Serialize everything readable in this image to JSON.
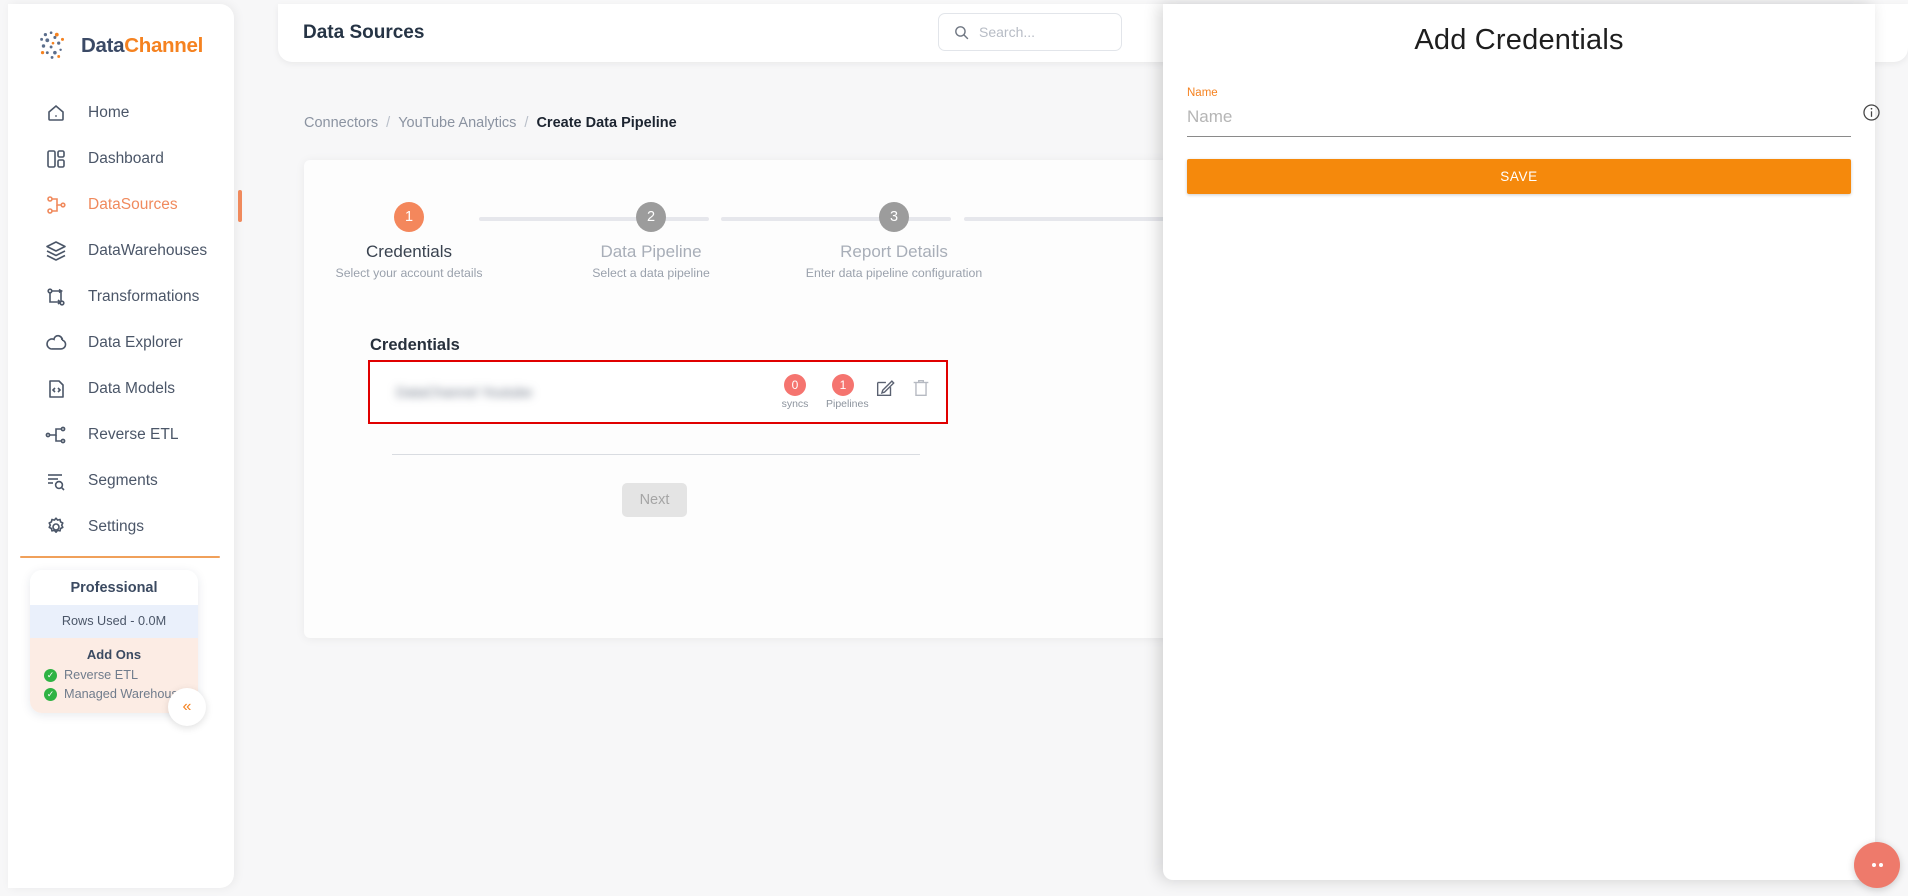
{
  "brand": {
    "part1": "Data",
    "part2": "Channel"
  },
  "sidebar": {
    "items": [
      {
        "label": "Home",
        "icon": "home-icon",
        "active": false
      },
      {
        "label": "Dashboard",
        "icon": "dashboard-icon",
        "active": false
      },
      {
        "label": "DataSources",
        "icon": "datasources-icon",
        "active": true
      },
      {
        "label": "DataWarehouses",
        "icon": "warehouse-icon",
        "active": false
      },
      {
        "label": "Transformations",
        "icon": "transformations-icon",
        "active": false
      },
      {
        "label": "Data Explorer",
        "icon": "explorer-icon",
        "active": false
      },
      {
        "label": "Data Models",
        "icon": "models-icon",
        "active": false
      },
      {
        "label": "Reverse ETL",
        "icon": "reverse-etl-icon",
        "active": false
      },
      {
        "label": "Segments",
        "icon": "segments-icon",
        "active": false
      },
      {
        "label": "Settings",
        "icon": "gear-icon",
        "active": false
      }
    ],
    "plan": {
      "title": "Professional",
      "rows_used": "Rows Used - 0.0M",
      "addons_title": "Add Ons",
      "addons": [
        {
          "label": "Reverse ETL"
        },
        {
          "label": "Managed Warehouse"
        }
      ]
    },
    "collapse_icon": "«"
  },
  "topbar": {
    "title": "Data Sources",
    "search_placeholder": "Search..."
  },
  "breadcrumb": {
    "items": [
      {
        "label": "Connectors",
        "current": false
      },
      {
        "label": "YouTube Analytics",
        "current": false
      },
      {
        "label": "Create Data Pipeline",
        "current": true
      }
    ],
    "separator": "/"
  },
  "stepper": {
    "steps": [
      {
        "number": "1",
        "title": "Credentials",
        "subtitle": "Select your account details",
        "state": "active"
      },
      {
        "number": "2",
        "title": "Data Pipeline",
        "subtitle": "Select a data pipeline",
        "state": "inactive"
      },
      {
        "number": "3",
        "title": "Report Details",
        "subtitle": "Enter data pipeline configuration",
        "state": "inactive"
      }
    ]
  },
  "credentials": {
    "heading": "Credentials",
    "refresh_icon": "refresh-icon",
    "add_icon": "+",
    "rows": [
      {
        "name": "DataChannel Youtube",
        "redacted": true,
        "syncs_count": "0",
        "syncs_label": "syncs",
        "pipelines_count": "1",
        "pipelines_label": "Pipelines"
      }
    ],
    "next_label": "Next"
  },
  "panel": {
    "title": "Add Credentials",
    "name_label": "Name",
    "name_value": "",
    "name_placeholder": "Name",
    "save_label": "SAVE",
    "info_icon": "info-icon"
  },
  "colors": {
    "accent_orange": "#f58220",
    "step_active": "#f4875c",
    "badge_red": "#f5746f",
    "highlight_red": "#e00000",
    "save_orange": "#f5890c",
    "sidebar_text": "#4b5668"
  }
}
